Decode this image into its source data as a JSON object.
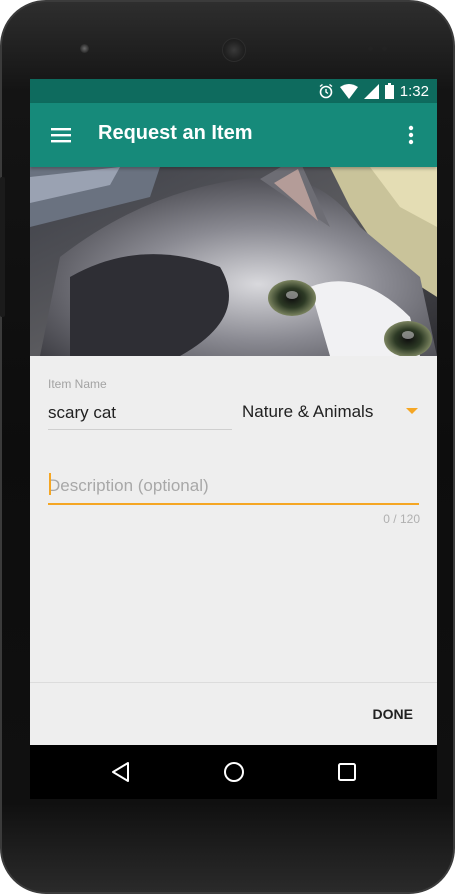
{
  "status_bar": {
    "time": "1:32",
    "icons": [
      "alarm-icon",
      "wifi-icon",
      "signal-icon",
      "battery-icon"
    ]
  },
  "app_bar": {
    "title": "Request an Item",
    "menu_icon": "hamburger-menu-icon",
    "overflow_icon": "more-vert-icon",
    "color": "#168a7a",
    "status_color": "#0e6b5e"
  },
  "photo": {
    "subject": "cat-photo"
  },
  "form": {
    "item_name_label": "Item Name",
    "item_name_value": "scary cat",
    "category_value": "Nature & Animals",
    "description_value": "",
    "description_placeholder": "Description (optional)",
    "char_counter": "0 / 120",
    "accent_color": "#f5a623"
  },
  "actions": {
    "done_label": "DONE"
  },
  "nav_bar": {
    "buttons": [
      "back-icon",
      "home-icon",
      "recents-icon"
    ]
  }
}
